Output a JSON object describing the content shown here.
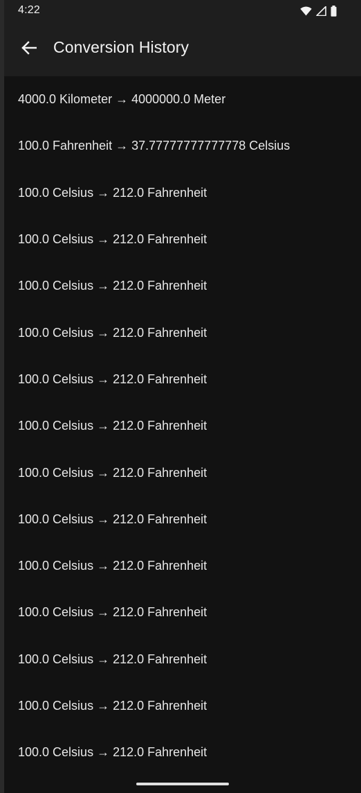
{
  "status_bar": {
    "time": "4:22",
    "icons": [
      "wifi-icon",
      "signal-icon",
      "battery-icon"
    ]
  },
  "app_bar": {
    "title": "Conversion History",
    "back_icon": "arrow-back-icon"
  },
  "history": [
    "4000.0 Kilometer → 4000000.0 Meter",
    "100.0 Fahrenheit → 37.77777777777778 Celsius",
    "100.0 Celsius → 212.0 Fahrenheit",
    "100.0 Celsius → 212.0 Fahrenheit",
    "100.0 Celsius → 212.0 Fahrenheit",
    "100.0 Celsius → 212.0 Fahrenheit",
    "100.0 Celsius → 212.0 Fahrenheit",
    "100.0 Celsius → 212.0 Fahrenheit",
    "100.0 Celsius → 212.0 Fahrenheit",
    "100.0 Celsius → 212.0 Fahrenheit",
    "100.0 Celsius → 212.0 Fahrenheit",
    "100.0 Celsius → 212.0 Fahrenheit",
    "100.0 Celsius → 212.0 Fahrenheit",
    "100.0 Celsius → 212.0 Fahrenheit",
    "100.0 Celsius → 212.0 Fahrenheit"
  ],
  "colors": {
    "background": "#121212",
    "app_bar": "#1e1e1e",
    "text": "#e8e8e8"
  }
}
